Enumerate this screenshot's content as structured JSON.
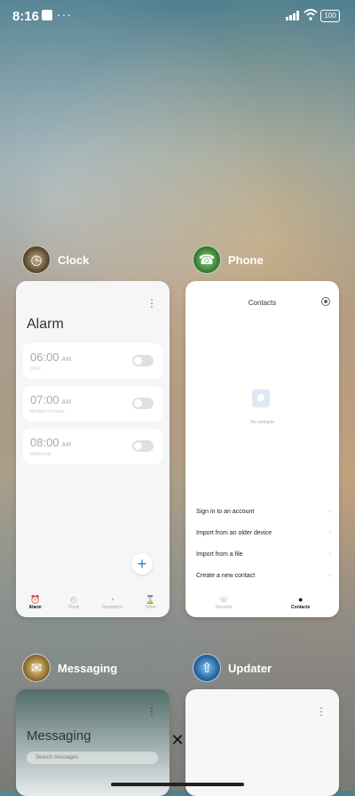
{
  "status_bar": {
    "time": "8:16",
    "dots": "···",
    "battery": "100"
  },
  "apps": {
    "clock": {
      "name": "Clock",
      "title": "Alarm",
      "alarms": [
        {
          "time": "06:00",
          "ampm": "AM",
          "subtitle": "Once"
        },
        {
          "time": "07:00",
          "ampm": "AM",
          "subtitle": "Monday to Friday"
        },
        {
          "time": "08:00",
          "ampm": "AM",
          "subtitle": "Weekends"
        }
      ],
      "fab": "+",
      "nav": [
        "Alarm",
        "Clock",
        "Stopwatch",
        "Timer"
      ]
    },
    "phone": {
      "name": "Phone",
      "title": "Contacts",
      "empty_text": "No contacts",
      "actions": [
        "Sign in to an account",
        "Import from an older device",
        "Import from a file",
        "Create a new contact"
      ],
      "nav": [
        "Recents",
        "Contacts"
      ]
    },
    "messaging": {
      "name": "Messaging",
      "title": "Messaging",
      "search": "Search messages"
    },
    "updater": {
      "name": "Updater"
    }
  },
  "controls": {
    "close": "✕"
  }
}
